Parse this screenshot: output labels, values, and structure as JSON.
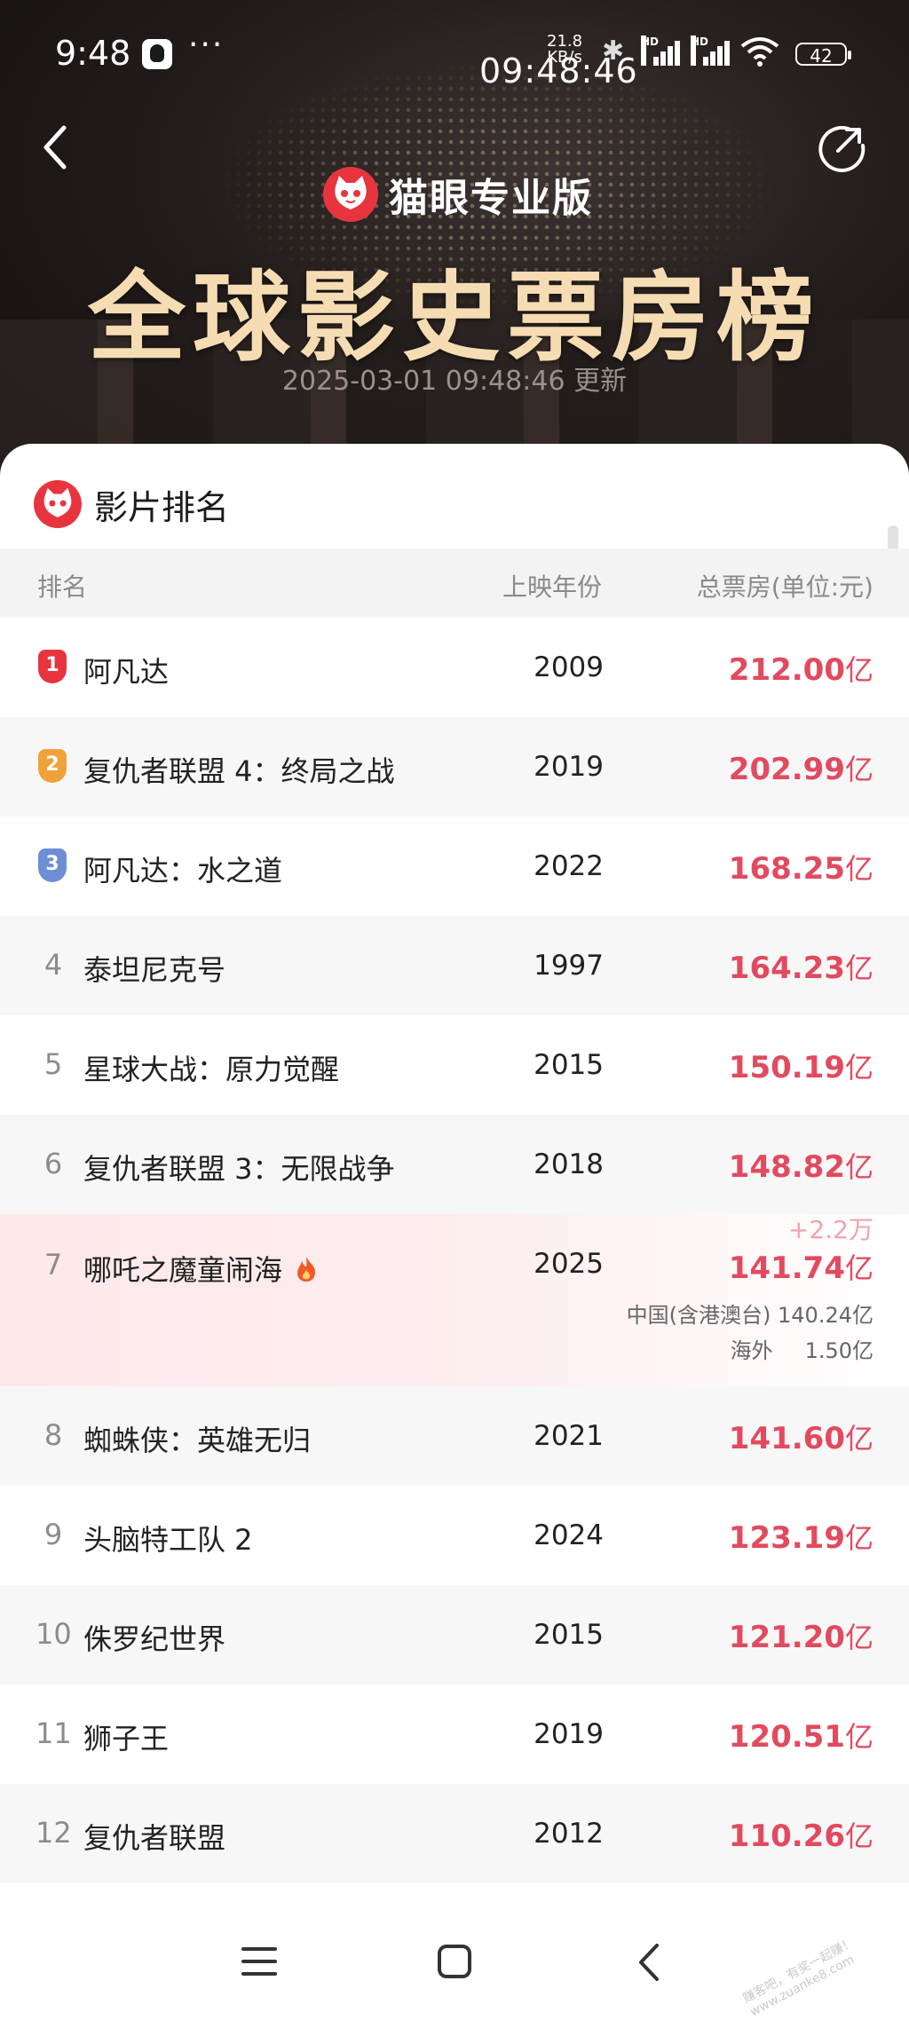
{
  "status_bar": {
    "time": "9:48",
    "dots": "···",
    "clock_overlay": "09:48:46",
    "net_speed": "21.8",
    "net_unit": "KB/s",
    "hd1": "HD",
    "hd2": "HD",
    "battery": "42"
  },
  "header": {
    "brand": "猫眼专业版",
    "title": "全球影史票房榜",
    "updated": "2025-03-01 09:48:46 更新"
  },
  "section": {
    "title": "影片排名"
  },
  "columns": {
    "rank": "排名",
    "year": "上映年份",
    "gross": "总票房(单位:元)"
  },
  "unit": "亿",
  "colors": {
    "accent": "#e24a5f",
    "brand_red": "#e8343f",
    "gold1": "#e8343f",
    "gold2": "#f0a23a",
    "gold3": "#6e8fd4"
  },
  "rows": [
    {
      "rank": "1",
      "title": "阿凡达",
      "year": "2009",
      "gross": "212.00"
    },
    {
      "rank": "2",
      "title": "复仇者联盟 4：终局之战",
      "year": "2019",
      "gross": "202.99"
    },
    {
      "rank": "3",
      "title": "阿凡达：水之道",
      "year": "2022",
      "gross": "168.25"
    },
    {
      "rank": "4",
      "title": "泰坦尼克号",
      "year": "1997",
      "gross": "164.23"
    },
    {
      "rank": "5",
      "title": "星球大战：原力觉醒",
      "year": "2015",
      "gross": "150.19"
    },
    {
      "rank": "6",
      "title": "复仇者联盟 3：无限战争",
      "year": "2018",
      "gross": "148.82"
    },
    {
      "rank": "7",
      "title": "哪吒之魔童闹海",
      "year": "2025",
      "gross": "141.74",
      "delta": "+2.2万",
      "china_label": "中国(含港澳台)",
      "china_value": "140.24亿",
      "overseas_label": "海外",
      "overseas_value": "1.50亿"
    },
    {
      "rank": "8",
      "title": "蜘蛛侠：英雄无归",
      "year": "2021",
      "gross": "141.60"
    },
    {
      "rank": "9",
      "title": "头脑特工队 2",
      "year": "2024",
      "gross": "123.19"
    },
    {
      "rank": "10",
      "title": "侏罗纪世界",
      "year": "2015",
      "gross": "121.20"
    },
    {
      "rank": "11",
      "title": "狮子王",
      "year": "2019",
      "gross": "120.51"
    },
    {
      "rank": "12",
      "title": "复仇者联盟",
      "year": "2012",
      "gross": "110.26"
    }
  ],
  "watermark": "赚客吧，有奖一起赚！ www.zuanke8.com"
}
